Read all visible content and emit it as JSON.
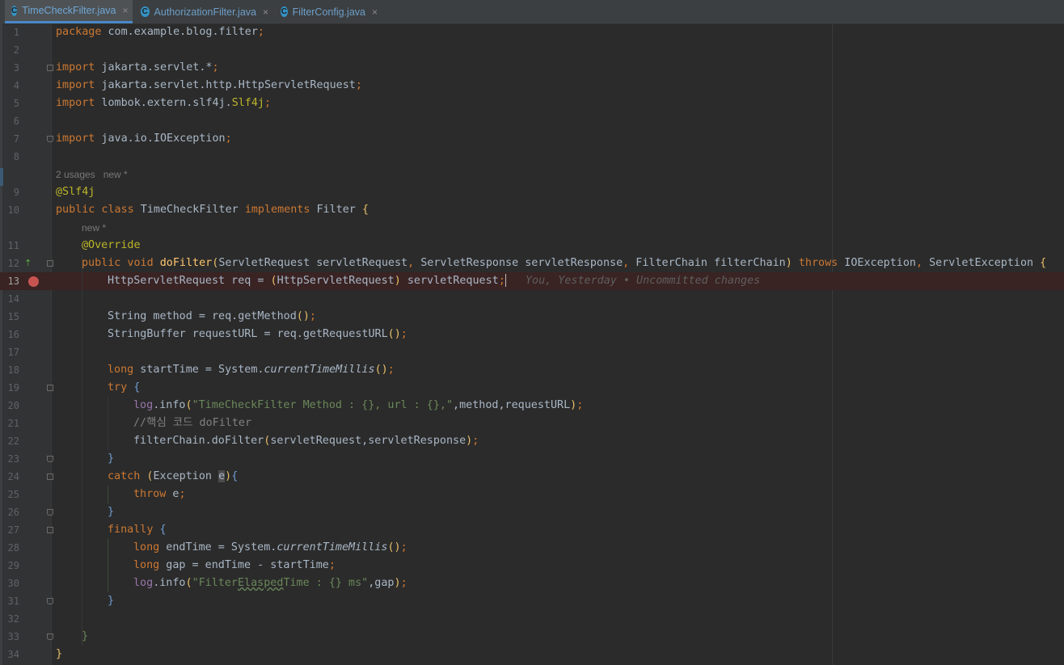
{
  "tabs": [
    {
      "label": "TimeCheckFilter.java",
      "active": true
    },
    {
      "label": "AuthorizationFilter.java",
      "active": false
    },
    {
      "label": "FilterConfig.java",
      "active": false
    }
  ],
  "close_glyph": "×",
  "tab_icon_letter": "C",
  "line_numbers": [
    "1",
    "2",
    "3",
    "4",
    "5",
    "6",
    "7",
    "8",
    "9",
    "10",
    "11",
    "12",
    "13",
    "14",
    "15",
    "16",
    "17",
    "18",
    "19",
    "20",
    "21",
    "22",
    "23",
    "24",
    "25",
    "26",
    "27",
    "28",
    "29",
    "30",
    "31",
    "32",
    "33",
    "34"
  ],
  "hints": {
    "class_usages": "2 usages   new *",
    "method_new": "new *"
  },
  "code": {
    "l1_kw": "package",
    "l1_rest": " com.example.blog.filter",
    "semi": ";",
    "import_kw": "import",
    "l3_rest": " jakarta.servlet.*",
    "l4_rest": " jakarta.servlet.http.HttpServletRequest",
    "l5_rest": " lombok.extern.slf4j.",
    "l5_ann": "Slf4j",
    "l7_rest": " java.io.IOException",
    "l9_ann": "@Slf4j",
    "l10_public": "public",
    "l10_class": " class",
    "l10_name": " TimeCheckFilter ",
    "l10_implements": "implements",
    "l10_filter": " Filter ",
    "l11_ann": "@Override",
    "l12_public": "public",
    "l12_void": " void",
    "l12_fn": " doFilter",
    "l12_params1": "ServletRequest servletRequest",
    "l12_params2": " ServletResponse servletResponse",
    "l12_params3": " FilterChain filterChain",
    "l12_throws": " throws",
    "l12_ex1": " IOException",
    "l12_ex2": " ServletException ",
    "l13_code": "HttpServletRequest req = ",
    "l13_cast": "HttpServletRequest",
    "l13_rest": " servletRequest",
    "l13_blame": "You, Yesterday • Uncommitted changes",
    "l15_code": "String method = req.getMethod",
    "l16_code": "StringBuffer requestURL = req.getRequestURL",
    "l18_long": "long",
    "l18_a": " startTime = System.",
    "l18_fn": "currentTimeMillis",
    "l19_try": "try",
    "l20_log": "log",
    "l20_info": ".info",
    "l20_str": "\"TimeCheckFilter Method : {}, url : {},\"",
    "l20_rest": ",method,requestURL",
    "l21_cmt": "//핵심 코드 doFilter",
    "l22_a": "filterChain.doFilter",
    "l22_b": "servletRequest,servletResponse",
    "l24_catch": "catch",
    "l24_ex": "Exception ",
    "l24_e": "e",
    "l25_throw": "throw",
    "l25_rest": " e",
    "l27_finally": "finally",
    "l28_a": " endTime = System.",
    "l29_a": " gap = endTime - startTime",
    "l30_str_a": "\"Filter",
    "l30_str_ul": "Elasped",
    "l30_str_b": "Time : {} ms\"",
    "l30_rest": ",gap"
  }
}
